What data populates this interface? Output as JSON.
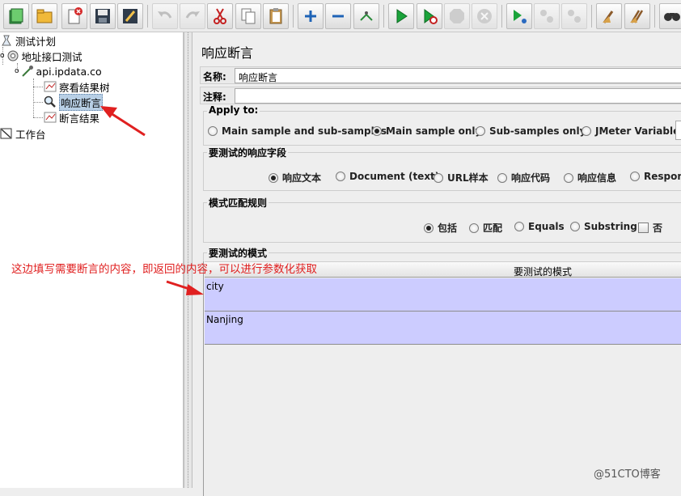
{
  "tree": {
    "root": "测试计划",
    "thread_group": "地址接口测试",
    "sampler": "api.ipdata.co",
    "listener_tree": "察看结果树",
    "assertion": "响应断言",
    "assertion_results": "断言结果",
    "workbench": "工作台"
  },
  "panel": {
    "title": "响应断言",
    "name_label": "名称:",
    "name_value": "响应断言",
    "comment_label": "注释:",
    "comment_value": ""
  },
  "apply_to": {
    "label": "Apply to:",
    "options": [
      "Main sample and sub-samples",
      "Main sample only",
      "Sub-samples only",
      "JMeter Variable"
    ],
    "selected": "Main sample only"
  },
  "response_field": {
    "label": "要测试的响应字段",
    "options": [
      "响应文本",
      "Document (text)",
      "URL样本",
      "响应代码",
      "响应信息",
      "Respons"
    ],
    "selected": "响应文本"
  },
  "pattern_rules": {
    "label": "模式匹配规则",
    "options": [
      "包括",
      "匹配",
      "Equals",
      "Substring"
    ],
    "selected": "包括",
    "not_label": "否",
    "not_checked": false
  },
  "patterns": {
    "label": "要测试的模式",
    "column_header": "要测试的模式",
    "rows": [
      "city",
      "Nanjing"
    ]
  },
  "annotation": {
    "text": "这边填写需要断言的内容，即返回的内容，可以进行参数化获取",
    "color": "#e02020"
  },
  "watermark": "@51CTO博客",
  "colors": {
    "row_highlight": "#ccccff",
    "tree_selection": "#b8cfe5",
    "annotation_red": "#e02020"
  },
  "toolbar_icons": [
    "new-icon",
    "templates-icon",
    "open-icon",
    "close-icon",
    "save-icon",
    "save-as-icon",
    "undo-icon",
    "redo-icon",
    "cut-icon",
    "copy-icon",
    "paste-icon",
    "expand-icon",
    "collapse-icon",
    "toggle-icon",
    "start-icon",
    "start-no-pause-icon",
    "stop-icon",
    "shutdown-icon",
    "remote-start-icon",
    "remote-stop-icon",
    "remote-shutdown-icon",
    "clear-icon",
    "clear-all-icon",
    "search-icon"
  ]
}
